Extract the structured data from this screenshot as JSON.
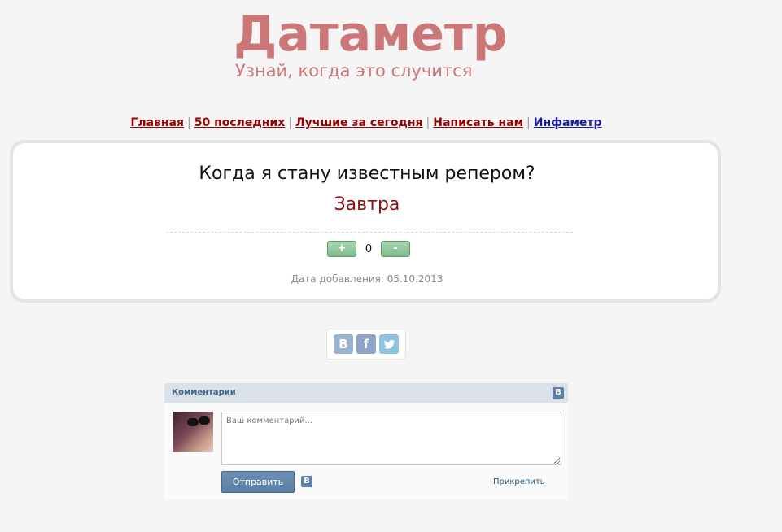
{
  "header": {
    "logo": "Датаметр",
    "tagline": "Узнай, когда это случится"
  },
  "nav": {
    "items": [
      {
        "label": "Главная"
      },
      {
        "label": "50 последних"
      },
      {
        "label": "Лучшие за сегодня"
      },
      {
        "label": "Написать нам"
      },
      {
        "label": "Инфаметр"
      }
    ],
    "separator": "|"
  },
  "card": {
    "question": "Когда я стану известным репером?",
    "answer": "Завтра",
    "vote": {
      "plus_label": "+",
      "count": "0",
      "minus_label": "-"
    },
    "date": "Дата добавления: 05.10.2013"
  },
  "share": {
    "icons": [
      "vk-icon",
      "facebook-icon",
      "twitter-icon"
    ],
    "vk_glyph": "В",
    "fb_glyph": "f",
    "tw_glyph": "t"
  },
  "comments": {
    "title": "Комментарии",
    "vk_glyph": "В",
    "placeholder": "Ваш комментарий...",
    "send_label": "Отправить",
    "attach_label": "Прикрепить"
  },
  "colors": {
    "brand": "#cc7777",
    "link": "#990000",
    "answer": "#8b1111",
    "vk_blue": "#5b7fa6"
  }
}
